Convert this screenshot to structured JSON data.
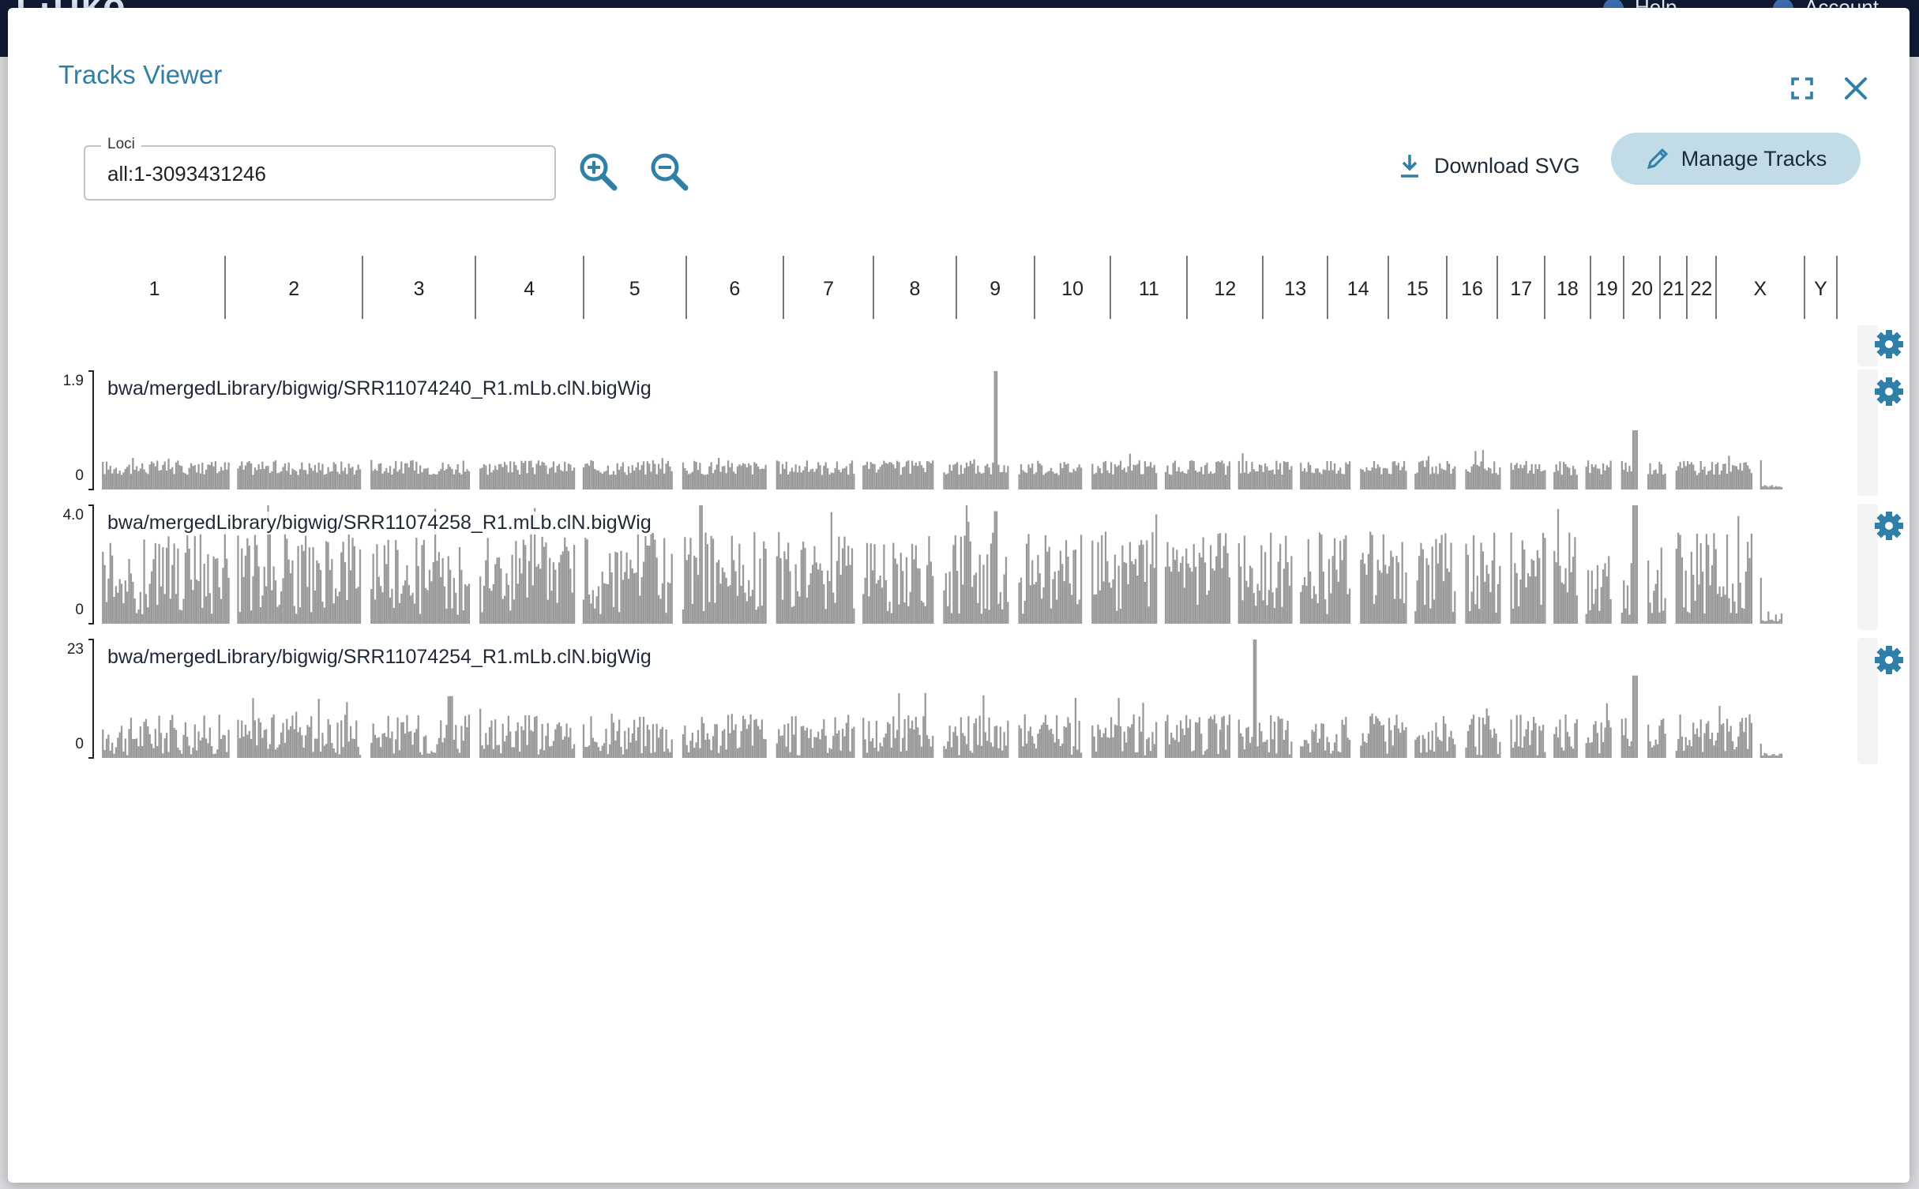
{
  "app_bar": {
    "brand": "L·Uko",
    "help_label": "Help",
    "account_label": "Account"
  },
  "dialog": {
    "title": "Tracks Viewer",
    "loci": {
      "label": "Loci",
      "value": "all:1-3093431246"
    },
    "download_label": "Download SVG",
    "manage_label": "Manage Tracks"
  },
  "ideogram": {
    "chromosomes": [
      "1",
      "2",
      "3",
      "4",
      "5",
      "6",
      "7",
      "8",
      "9",
      "10",
      "11",
      "12",
      "13",
      "14",
      "15",
      "16",
      "17",
      "18",
      "19",
      "20",
      "21",
      "22",
      "X",
      "Y"
    ],
    "lengths": [
      249,
      242,
      198,
      190,
      181,
      171,
      159,
      145,
      138,
      134,
      135,
      133,
      114,
      107,
      102,
      90,
      83,
      80,
      59,
      64,
      47,
      51,
      156,
      57
    ]
  },
  "tracks": [
    {
      "name": "bwa/mergedLibrary/bigwig/SRR11074240_R1.mLb.clN.bigWig",
      "max_label": "1.9",
      "min_label": "0",
      "max": 1.9,
      "base": 0.35,
      "noise": 0.12,
      "peaks": [
        [
          0.532,
          1.9
        ],
        [
          0.9105,
          0.95
        ]
      ]
    },
    {
      "name": "bwa/mergedLibrary/bigwig/SRR11074258_R1.mLb.clN.bigWig",
      "max_label": "4.0",
      "min_label": "0",
      "max": 4.0,
      "base": 1.7,
      "noise": 1.4,
      "peaks": [
        [
          0.3575,
          4.0
        ],
        [
          0.532,
          3.8
        ],
        [
          0.9105,
          4.0
        ]
      ]
    },
    {
      "name": "bwa/mergedLibrary/bigwig/SRR11074254_R1.mLb.clN.bigWig",
      "max_label": "23",
      "min_label": "0",
      "max": 23,
      "base": 4.5,
      "noise": 4.0,
      "peaks": [
        [
          0.686,
          23
        ],
        [
          0.9105,
          16
        ],
        [
          0.2095,
          12
        ]
      ]
    }
  ]
}
